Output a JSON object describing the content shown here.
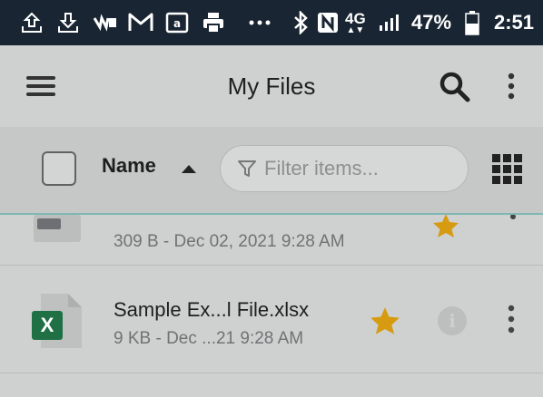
{
  "status_bar": {
    "battery": "47%",
    "time": "2:51",
    "network": "4G",
    "icons": [
      "upload-icon",
      "download-icon",
      "video-icon",
      "gmail-icon",
      "amazon-icon",
      "printer-icon",
      "more-dots-icon",
      "bluetooth-icon",
      "nfc-icon",
      "network-4g-icon",
      "signal-icon",
      "battery-icon"
    ]
  },
  "app_bar": {
    "title": "My Files",
    "menu_icon": "menu-icon",
    "search_icon": "search-icon",
    "overflow_icon": "more-vertical-icon"
  },
  "toolbar": {
    "sort_label": "Name",
    "sort_direction": "ascending",
    "filter_placeholder": "Filter items...",
    "view_toggle_icon": "grid-view-icon"
  },
  "files": [
    {
      "name": "",
      "meta": "309 B - Dec 02, 2021 9:28 AM",
      "starred": true,
      "icon": "document-icon"
    },
    {
      "name": "Sample Ex...l File.xlsx",
      "meta": "9 KB - Dec ...21 9:28 AM",
      "starred": true,
      "icon": "excel-file-icon",
      "excel_badge": "X"
    }
  ],
  "colors": {
    "status_bar": "#1a2533",
    "star": "#d79b12",
    "excel_green": "#1f7145",
    "accent_line": "#7fb7b3"
  }
}
